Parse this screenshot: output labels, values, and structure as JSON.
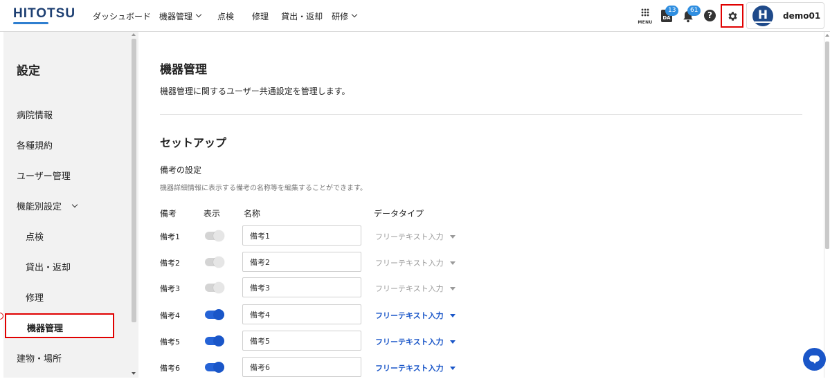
{
  "header": {
    "logo": "HITOTSU",
    "nav": [
      {
        "label": "ダッシュボード",
        "has_menu": false
      },
      {
        "label": "機器管理",
        "has_menu": true
      },
      {
        "label": "点検",
        "has_menu": false
      },
      {
        "label": "修理",
        "has_menu": false
      },
      {
        "label": "貸出・返却",
        "has_menu": false
      },
      {
        "label": "研修",
        "has_menu": true
      }
    ],
    "menu_label": "MENU",
    "da_label": "DA",
    "da_badge": "13",
    "bell_badge": "61",
    "help_symbol": "?",
    "avatar_letter": "H",
    "username": "demo01",
    "accent_color": "#1a56c8",
    "highlight_color": "#e00000"
  },
  "sidebar": {
    "title": "設定",
    "items": [
      {
        "label": "病院情報"
      },
      {
        "label": "各種規約"
      },
      {
        "label": "ユーザー管理"
      },
      {
        "label": "機能別設定",
        "expandable": true
      },
      {
        "label": "点検",
        "sub": true
      },
      {
        "label": "貸出・返却",
        "sub": true
      },
      {
        "label": "修理",
        "sub": true
      },
      {
        "label": "機器管理",
        "sub": true,
        "active": true
      },
      {
        "label": "建物・場所"
      }
    ]
  },
  "main": {
    "title": "機器管理",
    "description": "機器管理に関するユーザー共通設定を管理します。",
    "section_title": "セットアップ",
    "subsection_title": "備考の設定",
    "subsection_desc": "機器詳細情報に表示する備考の名称等を編集することができます。",
    "columns": {
      "note": "備考",
      "display": "表示",
      "name": "名称",
      "datatype": "データタイプ"
    },
    "rows": [
      {
        "label": "備考1",
        "enabled": false,
        "name": "備考1",
        "datatype": "フリーテキスト入力"
      },
      {
        "label": "備考2",
        "enabled": false,
        "name": "備考2",
        "datatype": "フリーテキスト入力"
      },
      {
        "label": "備考3",
        "enabled": false,
        "name": "備考3",
        "datatype": "フリーテキスト入力"
      },
      {
        "label": "備考4",
        "enabled": true,
        "name": "備考4",
        "datatype": "フリーテキスト入力"
      },
      {
        "label": "備考5",
        "enabled": true,
        "name": "備考5",
        "datatype": "フリーテキスト入力"
      },
      {
        "label": "備考6",
        "enabled": true,
        "name": "備考6",
        "datatype": "フリーテキスト入力"
      }
    ]
  }
}
